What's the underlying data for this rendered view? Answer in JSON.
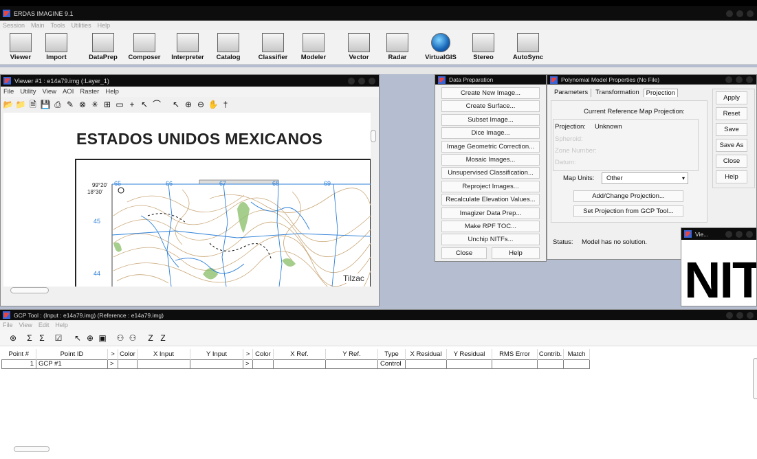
{
  "app": {
    "title": "ERDAS IMAGINE 9.1",
    "menu": [
      "Session",
      "Main",
      "Tools",
      "Utilities",
      "Help"
    ],
    "toolbar": [
      {
        "label": "Viewer",
        "icon": "viewer-icon"
      },
      {
        "label": "Import",
        "icon": "import-icon"
      },
      {
        "label": "DataPrep",
        "icon": "dataprep-icon"
      },
      {
        "label": "Composer",
        "icon": "composer-icon"
      },
      {
        "label": "Interpreter",
        "icon": "interpreter-icon"
      },
      {
        "label": "Catalog",
        "icon": "catalog-icon"
      },
      {
        "label": "Classifier",
        "icon": "classifier-icon"
      },
      {
        "label": "Modeler",
        "icon": "modeler-icon"
      },
      {
        "label": "Vector",
        "icon": "vector-icon"
      },
      {
        "label": "Radar",
        "icon": "radar-icon"
      },
      {
        "label": "VirtualGIS",
        "icon": "globe-icon"
      },
      {
        "label": "Stereo",
        "icon": "stereo-icon"
      },
      {
        "label": "AutoSync",
        "icon": "autosync-icon"
      }
    ]
  },
  "viewer": {
    "title": "Viewer #1 : e14a79.img (:Layer_1)",
    "menu": [
      "File",
      "Utility",
      "View",
      "AOI",
      "Raster",
      "Help"
    ],
    "map": {
      "heading": "ESTADOS UNIDOS MEXICANOS",
      "coord_lon": "99°20'",
      "coord_lat": "18°30'",
      "grid_cols": [
        "65",
        "66",
        "67",
        "68",
        "69"
      ],
      "grid_rows": [
        "45",
        "44"
      ],
      "place": "Tilzac"
    }
  },
  "data_prep": {
    "title": "Data Preparation",
    "buttons": [
      "Create New Image...",
      "Create Surface...",
      "Subset Image...",
      "Dice Image...",
      "Image Geometric Correction...",
      "Mosaic Images...",
      "Unsupervised Classification...",
      "Reproject Images...",
      "Recalculate Elevation Values...",
      "Imagizer Data Prep...",
      "Make RPF TOC...",
      "Unchip NITFs..."
    ],
    "close": "Close",
    "help": "Help"
  },
  "poly": {
    "title": "Polynomial Model Properties (No File)",
    "tabs": [
      "Parameters",
      "Transformation",
      "Projection"
    ],
    "section_title": "Current Reference Map Projection:",
    "projection_label": "Projection:",
    "projection_value": "Unknown",
    "spheroid_label": "Spheroid:",
    "zone_label": "Zone Number:",
    "datum_label": "Datum:",
    "map_units_label": "Map Units:",
    "map_units_value": "Other",
    "add_change": "Add/Change Projection...",
    "set_from_gcp": "Set Projection from GCP Tool...",
    "status_label": "Status:",
    "status_value": "Model has no solution.",
    "side_buttons": [
      "Apply",
      "Reset",
      "Save",
      "Save As",
      "Close",
      "Help"
    ]
  },
  "viewer2": {
    "title": "Vie...",
    "text": "NIT"
  },
  "gcp": {
    "title": "GCP Tool : (Input : e14a79.img) (Reference : e14a79.img)",
    "menu": [
      "File",
      "View",
      "Edit",
      "Help"
    ],
    "columns": [
      "Point #",
      "Point ID",
      ">",
      "Color",
      "X Input",
      "Y Input",
      ">",
      "Color",
      "X Ref.",
      "Y Ref.",
      "Type",
      "X Residual",
      "Y Residual",
      "RMS Error",
      "Contrib.",
      "Match"
    ],
    "rows": [
      [
        "1",
        "GCP #1",
        ">",
        "",
        "",
        "",
        ">",
        "",
        "",
        "",
        "Control",
        "",
        "",
        "",
        "",
        ""
      ]
    ]
  },
  "colors": {
    "title_bar": "#0d0d0d",
    "desktop": "#b4bed0",
    "map_grid": "#2c7fd8",
    "vegetation": "#8fc06f"
  }
}
